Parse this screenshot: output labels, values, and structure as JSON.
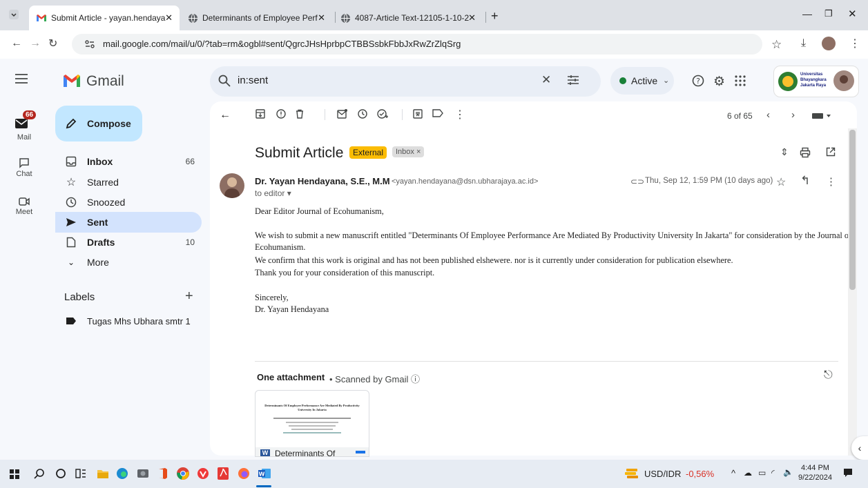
{
  "browser": {
    "tabs": [
      {
        "title": "Submit Article - yayan.hendaya",
        "active": true
      },
      {
        "title": "Determinants of Employee Perf",
        "active": false
      },
      {
        "title": "4087-Article Text-12105-1-10-2",
        "active": false
      }
    ],
    "new_tab": "+",
    "url": "mail.google.com/mail/u/0/?tab=rm&ogbl#sent/QgrcJHsHprbpCTBBSsbkFbbJxRwZrZlqSrg"
  },
  "gmail": {
    "logo_text": "Gmail",
    "search_value": "in:sent",
    "status": "Active",
    "account_org": [
      "Universitas",
      "Bhayangkara",
      "Jakarta Raya"
    ],
    "rail": {
      "mail_label": "Mail",
      "mail_badge": "66",
      "chat_label": "Chat",
      "meet_label": "Meet"
    },
    "compose_label": "Compose",
    "nav": [
      {
        "label": "Inbox",
        "count": "66"
      },
      {
        "label": "Starred",
        "count": ""
      },
      {
        "label": "Snoozed",
        "count": ""
      },
      {
        "label": "Sent",
        "count": ""
      },
      {
        "label": "Drafts",
        "count": "10"
      },
      {
        "label": "More",
        "count": ""
      }
    ],
    "labels_heading": "Labels",
    "labels_add": "+",
    "labels": [
      "Tugas Mhs Ubhara smtr 1"
    ],
    "pagination": "6 of 65"
  },
  "email": {
    "subject": "Submit Article",
    "tag_external": "External",
    "tag_inbox": "Inbox ×",
    "sender_name": "Dr. Yayan Hendayana, S.E., M.M",
    "sender_email": "<yayan.hendayana@dsn.ubharajaya.ac.id>",
    "to": "to editor ▾",
    "date": "Thu, Sep 12, 1:59 PM (10 days ago)",
    "body": [
      "Dear Editor Journal of Ecohumanism,",
      "We wish to submit a new manuscrift entitled \"Determinants Of Employee Performance Are Mediated By Productivity University In Jakarta\" for consideration by the Journal of",
      "Ecohumanism.",
      "We confirm that this work is original and has not been published elshewere. nor is it currently under consideration for publication elsewhere.",
      "Thank you for your consideration of this manuscript.",
      "Sincerely,",
      "Dr. Yayan Hendayana"
    ],
    "attachment_heading": "One attachment",
    "attachment_scan": "• Scanned by Gmail ⓘ",
    "attachment_title": "Determinants Of",
    "thumb_lines": [
      "Determinants Of Employee Performance Are Mediated By Productivity",
      "University In Jakarta"
    ]
  },
  "taskbar": {
    "ticker": "USD/IDR",
    "change": "-0,56%",
    "time": "4:44 PM",
    "date": "9/22/2024"
  },
  "colors": {
    "external_tag": "#fbbc04",
    "sent_highlight": "#d3e3fd",
    "compose_bg": "#c2e7ff",
    "badge": "#b3261e",
    "active_dot": "#188038",
    "change_red": "#d93025"
  }
}
